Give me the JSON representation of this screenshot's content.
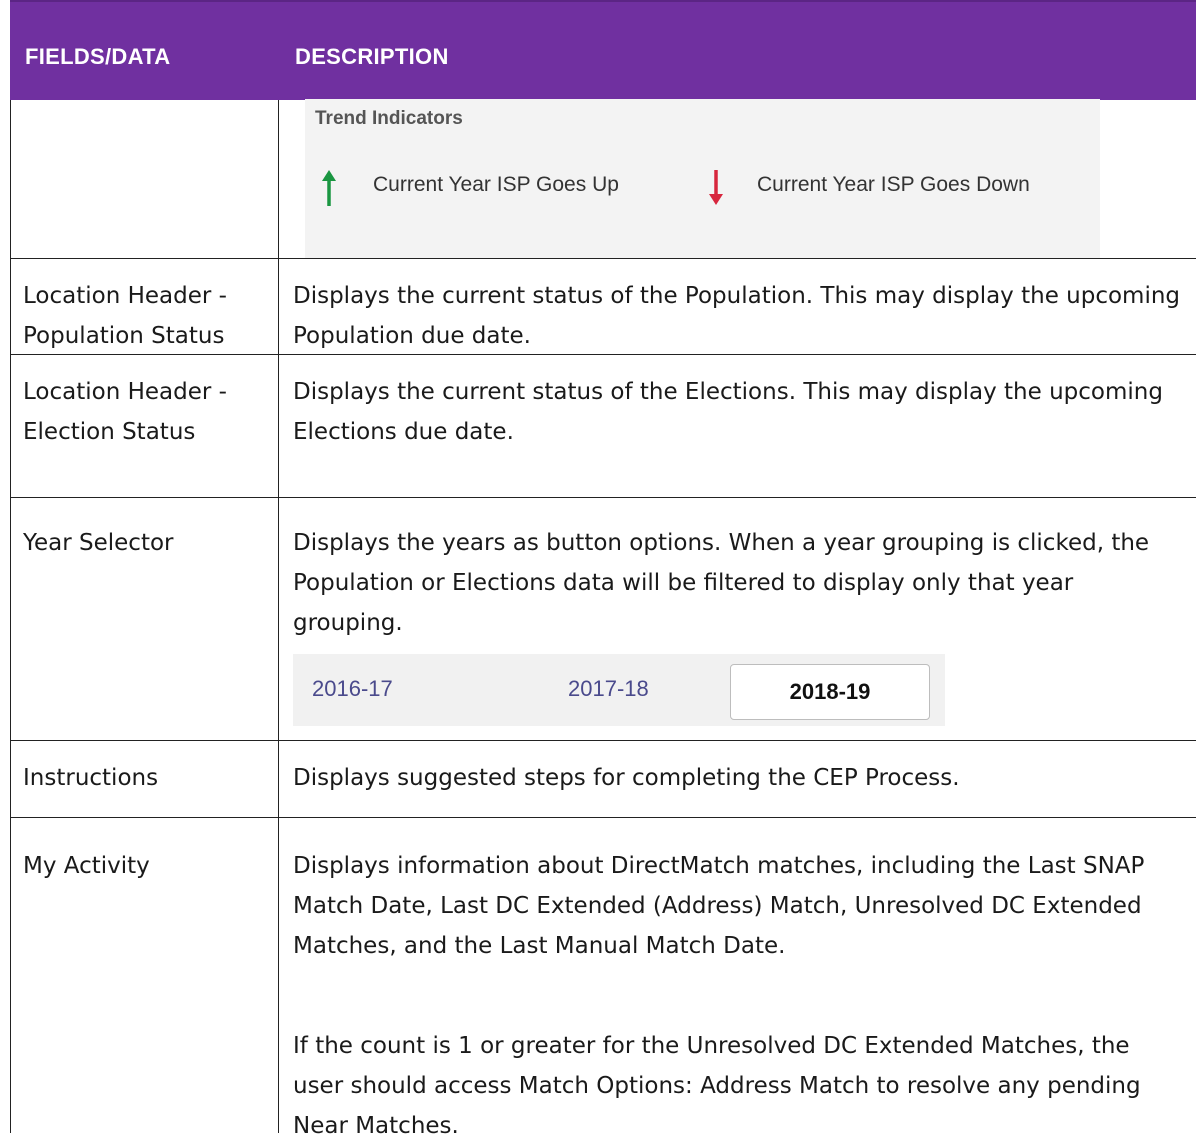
{
  "header": {
    "col1": "FIELDS/DATA",
    "col2": "DESCRIPTION"
  },
  "trend_indicators": {
    "title": "Trend Indicators",
    "up_label": "Current Year ISP Goes Up",
    "down_label": "Current Year ISP Goes Down",
    "up_color": "#1a9641",
    "down_color": "#d7263d"
  },
  "rows": [
    {
      "field": "Location Header -\nPopulation Status",
      "description": "Displays the current status of the Population. This may display the upcoming Population due date."
    },
    {
      "field": "Location Header -\nElection Status",
      "description": "Displays the current status of the Elections. This may display the upcoming Elections due date."
    },
    {
      "field": "Year Selector",
      "description": "Displays the years as button options. When a year grouping is clicked, the Population or Elections data will be filtered to display only that year grouping."
    },
    {
      "field": "Instructions",
      "description": "Displays suggested steps for completing the CEP Process."
    },
    {
      "field": "My Activity",
      "description": "Displays information about DirectMatch matches, including the Last SNAP Match Date, Last DC Extended (Address) Match, Unresolved DC Extended Matches, and the Last Manual Match Date.",
      "description2": "If the count is 1 or greater for the Unresolved DC Extended Matches, the user should access Match Options: Address Match to resolve any pending Near Matches."
    }
  ],
  "year_selector": {
    "options": [
      "2016-17",
      "2017-18"
    ],
    "selected": "2018-19"
  }
}
